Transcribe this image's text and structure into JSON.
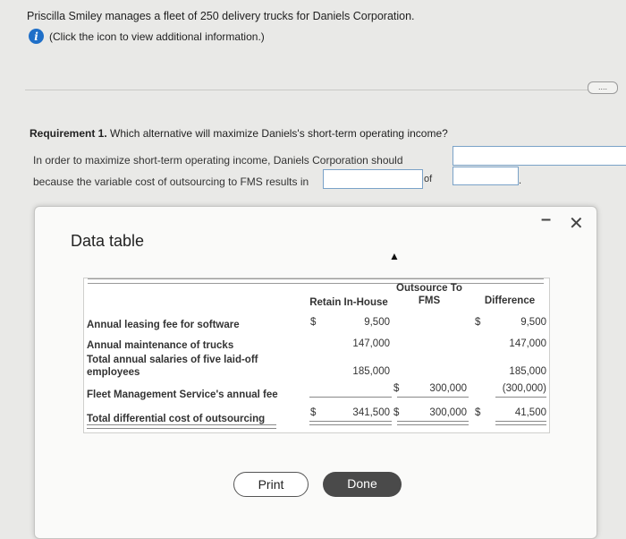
{
  "intro": {
    "text": "Priscilla Smiley manages a fleet of 250 delivery trucks for Daniels Corporation.",
    "info_link": "(Click the icon to view additional information.)"
  },
  "more_button": "....",
  "requirement": {
    "prefix": "Requirement 1.",
    "question": " Which alternative will maximize Daniels's short-term operating income?",
    "line1": "In order to maximize short-term operating income, Daniels Corporation should",
    "line2": "because the variable cost of outsourcing to FMS results in",
    "of_label": "of",
    "end_dot": ".",
    "answer_blanks": [
      "",
      "",
      ""
    ]
  },
  "modal": {
    "title": "Data table",
    "minimize": "–",
    "close": "✕",
    "columns": {
      "retain": "Retain In-House",
      "outsource_line1": "Outsource To",
      "outsource_line2": "FMS",
      "difference": "Difference"
    },
    "rows": [
      {
        "label": "Annual leasing fee for software",
        "retain_sym": "$",
        "retain": "9,500",
        "out_sym": "",
        "outsource": "",
        "diff_sym": "$",
        "difference": "9,500"
      },
      {
        "label": "Annual maintenance of trucks",
        "retain_sym": "",
        "retain": "147,000",
        "out_sym": "",
        "outsource": "",
        "diff_sym": "",
        "difference": "147,000"
      },
      {
        "label_line1": "Total annual salaries of five laid-off",
        "label_line2": "employees",
        "retain_sym": "",
        "retain": "185,000",
        "out_sym": "",
        "outsource": "",
        "diff_sym": "",
        "difference": "185,000"
      },
      {
        "label": "Fleet Management Service's annual fee",
        "retain_sym": "",
        "retain": "",
        "out_sym": "$",
        "outsource": "300,000",
        "diff_sym": "",
        "difference": "(300,000)"
      },
      {
        "label": "Total differential cost of outsourcing",
        "retain_sym": "$",
        "retain": "341,500",
        "out_sym": "$",
        "outsource": "300,000",
        "diff_sym": "$",
        "difference": "41,500"
      }
    ],
    "print_label": "Print",
    "done_label": "Done"
  }
}
